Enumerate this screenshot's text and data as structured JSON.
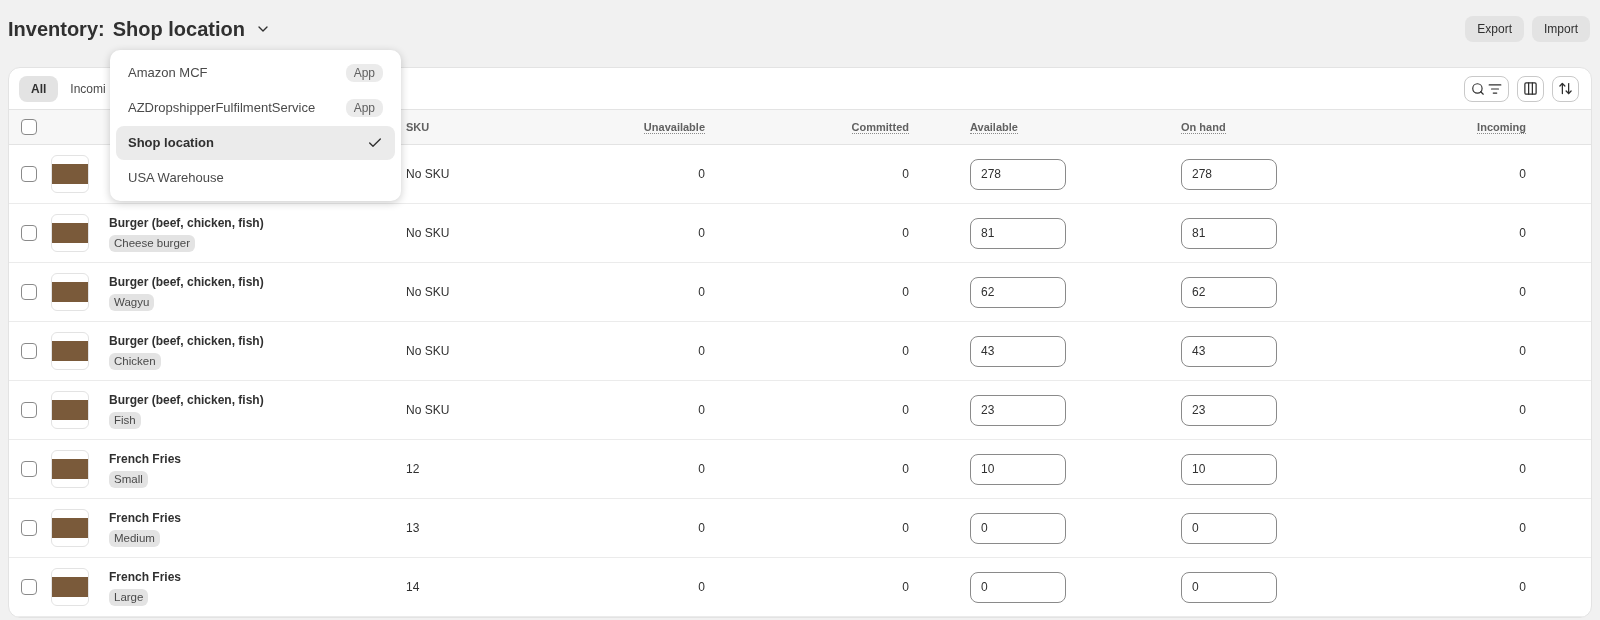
{
  "header": {
    "prefix": "Inventory:",
    "location": "Shop location",
    "actions": [
      "Export",
      "Import"
    ]
  },
  "tabs": [
    {
      "label": "All",
      "selected": true
    },
    {
      "label": "Incomi",
      "selected": false
    }
  ],
  "location_menu": [
    {
      "label": "Amazon MCF",
      "badge": "App",
      "selected": false
    },
    {
      "label": "AZDropshipperFulfilmentService",
      "badge": "App",
      "selected": false
    },
    {
      "label": "Shop location",
      "selected": true
    },
    {
      "label": "USA Warehouse",
      "selected": false
    }
  ],
  "table": {
    "select_all_checked": false,
    "columns": [
      "SKU",
      "Unavailable",
      "Committed",
      "Available",
      "On hand",
      "Incoming"
    ],
    "rows": [
      {
        "checked": false,
        "sku": "No SKU",
        "unavailable": "0",
        "committed": "0",
        "available": "278",
        "on_hand": "278",
        "incoming": "0"
      },
      {
        "checked": false,
        "product": "Burger (beef, chicken, fish)",
        "variant": "Cheese burger",
        "sku": "No SKU",
        "unavailable": "0",
        "committed": "0",
        "available": "81",
        "on_hand": "81",
        "incoming": "0"
      },
      {
        "checked": false,
        "product": "Burger (beef, chicken, fish)",
        "variant": "Wagyu",
        "sku": "No SKU",
        "unavailable": "0",
        "committed": "0",
        "available": "62",
        "on_hand": "62",
        "incoming": "0"
      },
      {
        "checked": false,
        "product": "Burger (beef, chicken, fish)",
        "variant": "Chicken",
        "sku": "No SKU",
        "unavailable": "0",
        "committed": "0",
        "available": "43",
        "on_hand": "43",
        "incoming": "0"
      },
      {
        "checked": false,
        "product": "Burger (beef, chicken, fish)",
        "variant": "Fish",
        "sku": "No SKU",
        "unavailable": "0",
        "committed": "0",
        "available": "23",
        "on_hand": "23",
        "incoming": "0"
      },
      {
        "checked": false,
        "product": "French Fries",
        "variant": "Small",
        "sku": "12",
        "unavailable": "0",
        "committed": "0",
        "available": "10",
        "on_hand": "10",
        "incoming": "0"
      },
      {
        "checked": false,
        "product": "French Fries",
        "variant": "Medium",
        "sku": "13",
        "unavailable": "0",
        "committed": "0",
        "available": "0",
        "on_hand": "0",
        "incoming": "0"
      },
      {
        "checked": false,
        "product": "French Fries",
        "variant": "Large",
        "sku": "14",
        "unavailable": "0",
        "committed": "0",
        "available": "0",
        "on_hand": "0",
        "incoming": "0"
      }
    ]
  }
}
